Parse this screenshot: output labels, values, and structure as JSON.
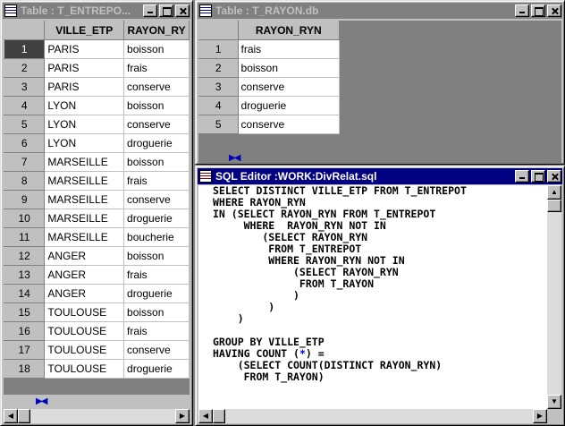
{
  "entrepot_window": {
    "title": "Table : T_ENTREPO...",
    "columns": [
      "VILLE_ETP",
      "RAYON_RY"
    ],
    "rows": [
      {
        "n": "1",
        "ville": "PARIS",
        "rayon": "boisson"
      },
      {
        "n": "2",
        "ville": "PARIS",
        "rayon": "frais"
      },
      {
        "n": "3",
        "ville": "PARIS",
        "rayon": "conserve"
      },
      {
        "n": "4",
        "ville": "LYON",
        "rayon": "boisson"
      },
      {
        "n": "5",
        "ville": "LYON",
        "rayon": "conserve"
      },
      {
        "n": "6",
        "ville": "LYON",
        "rayon": "droguerie"
      },
      {
        "n": "7",
        "ville": "MARSEILLE",
        "rayon": "boisson"
      },
      {
        "n": "8",
        "ville": "MARSEILLE",
        "rayon": "frais"
      },
      {
        "n": "9",
        "ville": "MARSEILLE",
        "rayon": "conserve"
      },
      {
        "n": "10",
        "ville": "MARSEILLE",
        "rayon": "droguerie"
      },
      {
        "n": "11",
        "ville": "MARSEILLE",
        "rayon": "boucherie"
      },
      {
        "n": "12",
        "ville": "ANGER",
        "rayon": "boisson"
      },
      {
        "n": "13",
        "ville": "ANGER",
        "rayon": "frais"
      },
      {
        "n": "14",
        "ville": "ANGER",
        "rayon": "droguerie"
      },
      {
        "n": "15",
        "ville": "TOULOUSE",
        "rayon": "boisson"
      },
      {
        "n": "16",
        "ville": "TOULOUSE",
        "rayon": "frais"
      },
      {
        "n": "17",
        "ville": "TOULOUSE",
        "rayon": "conserve"
      },
      {
        "n": "18",
        "ville": "TOULOUSE",
        "rayon": "droguerie"
      }
    ],
    "nav_icon": "record-nav-icon"
  },
  "rayon_window": {
    "title": "Table : T_RAYON.db",
    "columns": [
      "RAYON_RYN"
    ],
    "rows": [
      {
        "n": "1",
        "rayon": "frais"
      },
      {
        "n": "2",
        "rayon": "boisson"
      },
      {
        "n": "3",
        "rayon": "conserve"
      },
      {
        "n": "4",
        "rayon": "droguerie"
      },
      {
        "n": "5",
        "rayon": "conserve"
      }
    ],
    "nav_icon": "record-nav-icon"
  },
  "sql_window": {
    "title": "SQL Editor  :WORK:DivRelat.sql",
    "lines": [
      "SELECT DISTINCT VILLE_ETP FROM T_ENTREPOT",
      "WHERE RAYON_RYN",
      "IN (SELECT RAYON_RYN FROM T_ENTREPOT",
      "     WHERE  RAYON_RYN NOT IN",
      "        (SELECT RAYON_RYN",
      "         FROM T_ENTREPOT",
      "         WHERE RAYON_RYN NOT IN",
      "             (SELECT RAYON_RYN",
      "              FROM T_RAYON",
      "             )",
      "         )",
      "    )",
      "",
      "GROUP BY VILLE_ETP",
      "HAVING COUNT (*) =",
      "    (SELECT COUNT(DISTINCT RAYON_RYN)",
      "     FROM T_RAYON)"
    ]
  },
  "colors": {
    "active_title": "#000080",
    "inactive_title": "#808080",
    "face": "#c0c0c0",
    "nav_arrow": "#0000c0",
    "current_row": "#404040"
  }
}
